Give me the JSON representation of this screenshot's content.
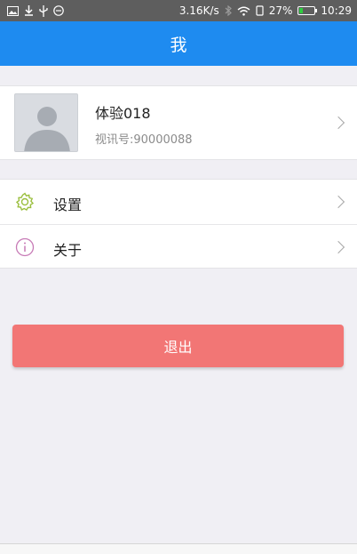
{
  "status_bar": {
    "net_speed": "3.16K/s",
    "battery_percent": "27%",
    "battery_level": 0.27,
    "time": "10:29",
    "icons": [
      "image-icon",
      "download-icon",
      "usb-icon",
      "messenger-icon",
      "bluetooth-icon",
      "wifi-icon",
      "vibrate-icon",
      "battery-icon"
    ]
  },
  "header": {
    "title": "我"
  },
  "profile": {
    "name": "体验018",
    "video_id": "视讯号:90000088"
  },
  "menu": {
    "items": [
      {
        "label": "设置",
        "icon": "gear-icon"
      },
      {
        "label": "关于",
        "icon": "info-icon"
      }
    ]
  },
  "logout": {
    "label": "退出"
  },
  "colors": {
    "header_bg": "#1e8bf0",
    "logout_bg": "#f27675",
    "gear_icon": "#9bbf3f",
    "info_icon": "#c77ab6",
    "page_bg": "#f0eff4"
  }
}
